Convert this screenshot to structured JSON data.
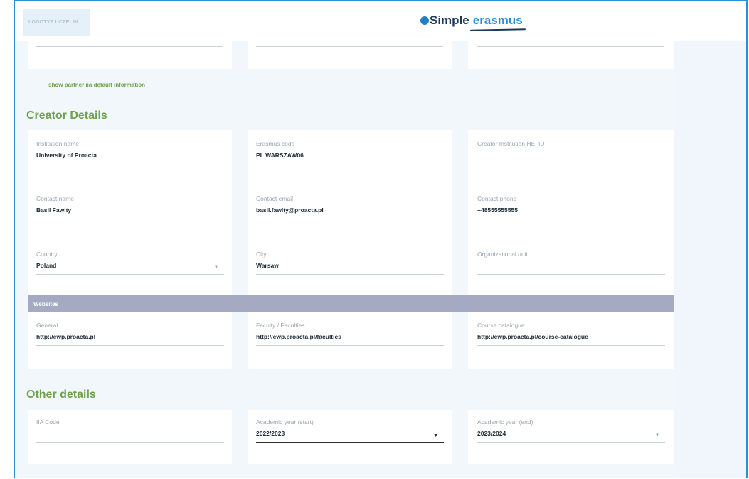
{
  "header": {
    "logo_placeholder": "LOGOTYP UCZELNI",
    "brand_simple": "Simple",
    "brand_erasmus": "erasmus"
  },
  "partner_link": "show partner iia default information",
  "creator": {
    "title": "Creator Details",
    "institution_name": {
      "label": "Institution name",
      "value": "University of Proacta"
    },
    "erasmus_code": {
      "label": "Erasmus code",
      "value": "PL WARSZAW06"
    },
    "hei_id": {
      "label": "Creator Institution HEI ID",
      "value": ""
    },
    "contact_name": {
      "label": "Contact name",
      "value": "Basil Fawlty"
    },
    "contact_email": {
      "label": "Contact email",
      "value": "basil.fawlty@proacta.pl"
    },
    "contact_phone": {
      "label": "Contact phone",
      "value": "+48555555555"
    },
    "country": {
      "label": "Country",
      "value": "Poland"
    },
    "city": {
      "label": "City",
      "value": "Warsaw"
    },
    "org_unit": {
      "label": "Organizational unit",
      "value": ""
    }
  },
  "websites": {
    "title": "Websites",
    "general": {
      "label": "General",
      "value": "http://ewp.proacta.pl"
    },
    "faculties": {
      "label": "Faculty / Faculties",
      "value": "http://ewp.proacta.pl/faculties"
    },
    "catalogue": {
      "label": "Course catalogue",
      "value": "http://ewp.proacta.pl/course-catalogue"
    }
  },
  "other": {
    "title": "Other details",
    "iia_code": {
      "label": "IIA Code",
      "value": ""
    },
    "year_start": {
      "label": "Academic year (start)",
      "value": "2022/2023"
    },
    "year_end": {
      "label": "Academic year (end)",
      "value": "2023/2024"
    }
  },
  "icons": {
    "dropdown": "caret-down-icon",
    "brand": "brand-dot-icon"
  },
  "colors": {
    "accent_green": "#6fa24e",
    "brand_blue": "#2b8fd8",
    "frame_blue": "#2a8fd6",
    "section_bar": "#a5aac2"
  }
}
